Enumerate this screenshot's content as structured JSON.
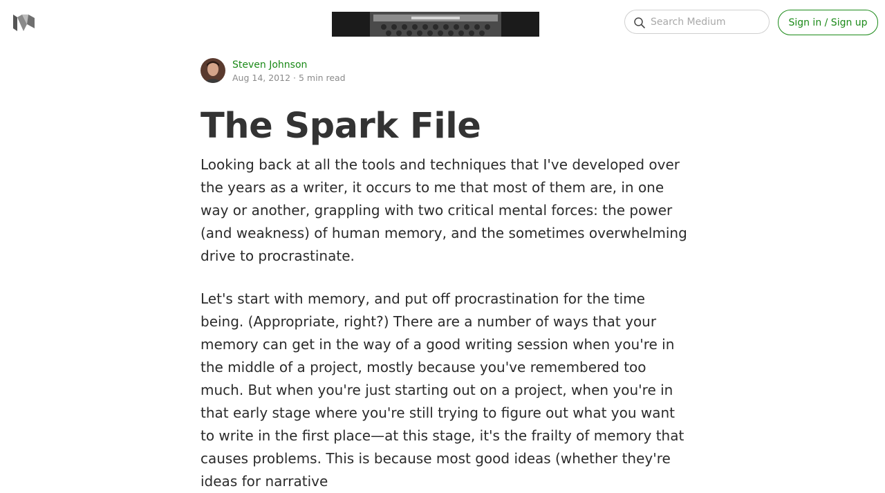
{
  "header": {
    "logo_icon": "medium-logo-icon",
    "search_icon": "search-icon",
    "search_placeholder": "Search Medium",
    "signin_label": "Sign in / Sign up",
    "accent_color": "#1a8917"
  },
  "article": {
    "author": "Steven Johnson",
    "date": "Aug 14, 2012",
    "separator": "·",
    "read_time": "5 min read",
    "title": "The Spark File",
    "paragraphs": [
      "Looking back at all the tools and techniques that I've developed over the years as a writer, it occurs to me that most of them are, in one way or another, grappling with two critical mental forces: the power (and weakness) of human memory, and the sometimes overwhelming drive to procrastinate.",
      "Let's start with memory, and put off procrastination for the time being. (Appropriate, right?) There are a number of ways that your memory can get in the way of a good writing session when you're in the middle of a project, mostly because you've remembered too much. But when you're just starting out on a project, when you're in that early stage where you're still trying to figure out what you want to write in the first place—at this stage, it's the frailty of memory that causes problems. This is because most good ideas (whether they're ideas for narrative"
    ]
  }
}
